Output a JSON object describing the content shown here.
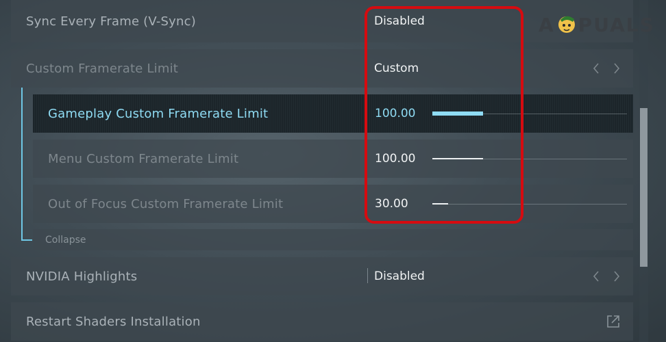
{
  "settings": {
    "vsync": {
      "label": "Sync Every Frame (V-Sync)",
      "value": "Disabled"
    },
    "framerate_limit": {
      "label": "Custom Framerate Limit",
      "value": "Custom"
    },
    "gameplay_limit": {
      "label": "Gameplay Custom Framerate Limit",
      "value": "100.00",
      "level": 0.26
    },
    "menu_limit": {
      "label": "Menu Custom Framerate Limit",
      "value": "100.00",
      "level": 0.26
    },
    "focus_limit": {
      "label": "Out of Focus Custom Framerate Limit",
      "value": "30.00",
      "level": 0.08
    },
    "collapse_label": "Collapse",
    "nvidia": {
      "label": "NVIDIA Highlights",
      "value": "Disabled"
    },
    "shaders": {
      "label": "Restart Shaders Installation"
    }
  },
  "watermark": {
    "text": "APPUALS"
  },
  "colors": {
    "accent": "#8fdcf4",
    "highlight": "#d60b10"
  },
  "icons": {
    "arrows": [
      "chevron-left-icon",
      "chevron-right-icon"
    ],
    "external": "external-link-icon"
  }
}
